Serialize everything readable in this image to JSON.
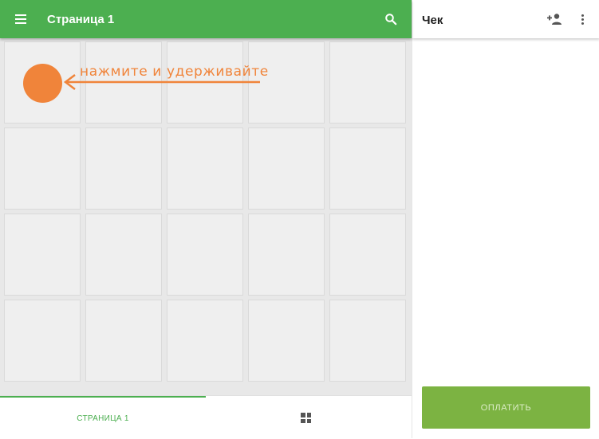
{
  "appbar": {
    "title": "Страница 1",
    "icons": {
      "menu": "menu-icon",
      "search": "search-icon"
    }
  },
  "grid": {
    "rows": 4,
    "columns": 5
  },
  "hint": {
    "text": "нажмите и удерживайте"
  },
  "bottom_tabs": [
    {
      "label": "СТРАНИЦА 1",
      "active": true
    },
    {
      "icon": "grid-icon",
      "active": false
    }
  ],
  "receipt": {
    "title": "Чек",
    "icons": {
      "add_customer": "add-person-icon",
      "more": "more-vert-icon"
    },
    "pay_label": "ОПЛАТИТЬ"
  },
  "colors": {
    "accent": "#4caf50",
    "pay_button": "#7cb342",
    "hint": "#f0843a",
    "tile": "#efefef",
    "background": "#e8e8e8"
  }
}
